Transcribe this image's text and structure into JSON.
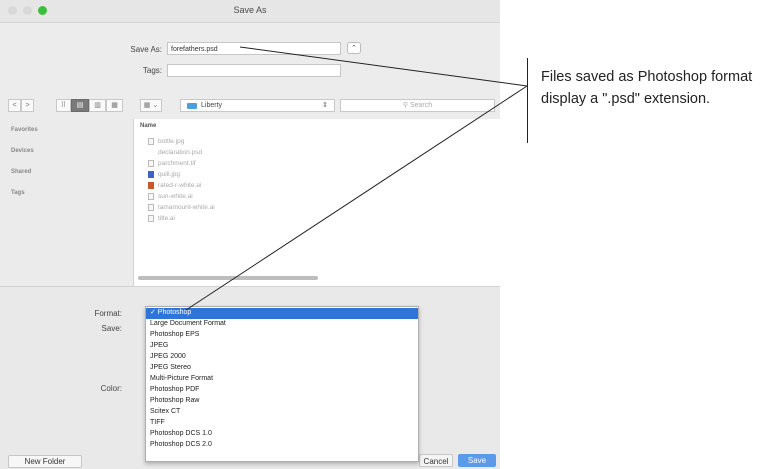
{
  "window": {
    "title": "Save As"
  },
  "form": {
    "save_as_label": "Save As:",
    "filename": "forefathers.psd",
    "tags_label": "Tags:",
    "tags_value": ""
  },
  "toolbar": {
    "back": "<",
    "forward": ">",
    "view_icons": "⠿",
    "view_list": "▤",
    "view_columns": "▥",
    "view_gallery": "▦",
    "arrange": "▦ ⌄",
    "location": "Liberty",
    "search_placeholder": "Search"
  },
  "sidebar": {
    "items": [
      {
        "label": "Favorites"
      },
      {
        "label": "Devices"
      },
      {
        "label": "Shared"
      },
      {
        "label": "Tags"
      }
    ]
  },
  "file_list": {
    "header": "Name",
    "files": [
      {
        "name": "bottle.jpg"
      },
      {
        "name": "declaration.psd"
      },
      {
        "name": "parchment.tif"
      },
      {
        "name": "quill.jpg"
      },
      {
        "name": "rated-r-white.ai"
      },
      {
        "name": "sun-white.ai"
      },
      {
        "name": "tamamount-white.ai"
      },
      {
        "name": "title.ai"
      }
    ]
  },
  "options": {
    "format_label": "Format:",
    "save_label": "Save:",
    "color_label": "Color:",
    "format_options": [
      "✓ Photoshop",
      "Large Document Format",
      "Photoshop EPS",
      "JPEG",
      "JPEG 2000",
      "JPEG Stereo",
      "Multi-Picture Format",
      "Photoshop PDF",
      "Photoshop Raw",
      "Scitex CT",
      "TIFF",
      "Photoshop DCS 1.0",
      "Photoshop DCS 2.0"
    ],
    "selected_format": "Photoshop"
  },
  "buttons": {
    "new_folder": "New Folder",
    "cancel": "Cancel",
    "save": "Save"
  },
  "callout": {
    "text": "Files saved as Photoshop format display a \".psd\" extension."
  },
  "colors": {
    "accent": "#2f74d9",
    "save_button": "#5b9ae8",
    "folder": "#4aa0dd",
    "zoom_button": "#3bbf3b"
  }
}
